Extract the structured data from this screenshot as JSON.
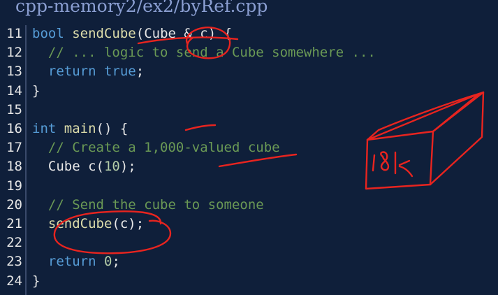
{
  "window": {
    "title": "cpp-memory2/ex2/byRef.cpp"
  },
  "editor": {
    "lines": [
      {
        "number": "11",
        "tokens": [
          {
            "t": "bool",
            "c": "kw"
          },
          {
            "t": " ",
            "c": "pl"
          },
          {
            "t": "sendCube",
            "c": "fn"
          },
          {
            "t": "(",
            "c": "pl"
          },
          {
            "t": "Cube",
            "c": "ty"
          },
          {
            "t": " & c) {",
            "c": "pl"
          }
        ]
      },
      {
        "number": "12",
        "tokens": [
          {
            "t": "  // ... logic to send a Cube somewhere ...",
            "c": "cm"
          }
        ]
      },
      {
        "number": "13",
        "tokens": [
          {
            "t": "  ",
            "c": "pl"
          },
          {
            "t": "return",
            "c": "kw"
          },
          {
            "t": " ",
            "c": "pl"
          },
          {
            "t": "true",
            "c": "kw"
          },
          {
            "t": ";",
            "c": "pl"
          }
        ]
      },
      {
        "number": "14",
        "tokens": [
          {
            "t": "}",
            "c": "pl"
          }
        ]
      },
      {
        "number": "15",
        "tokens": []
      },
      {
        "number": "16",
        "tokens": [
          {
            "t": "int",
            "c": "kw"
          },
          {
            "t": " ",
            "c": "pl"
          },
          {
            "t": "main",
            "c": "fn"
          },
          {
            "t": "() {",
            "c": "pl"
          }
        ]
      },
      {
        "number": "17",
        "tokens": [
          {
            "t": "  // Create a 1,000-valued cube",
            "c": "cm"
          }
        ]
      },
      {
        "number": "18",
        "tokens": [
          {
            "t": "  Cube c(",
            "c": "pl"
          },
          {
            "t": "10",
            "c": "num"
          },
          {
            "t": ");",
            "c": "pl"
          }
        ]
      },
      {
        "number": "19",
        "tokens": []
      },
      {
        "number": "20",
        "tokens": [
          {
            "t": "  // Send the cube to someone",
            "c": "cm"
          }
        ]
      },
      {
        "number": "21",
        "tokens": [
          {
            "t": "  ",
            "c": "pl"
          },
          {
            "t": "sendCube",
            "c": "fn"
          },
          {
            "t": "(c);",
            "c": "pl"
          }
        ]
      },
      {
        "number": "22",
        "tokens": []
      },
      {
        "number": "23",
        "tokens": [
          {
            "t": "  ",
            "c": "pl"
          },
          {
            "t": "return",
            "c": "kw"
          },
          {
            "t": " ",
            "c": "pl"
          },
          {
            "t": "0",
            "c": "num"
          },
          {
            "t": ";",
            "c": "pl"
          }
        ]
      },
      {
        "number": "24",
        "tokens": [
          {
            "t": "}",
            "c": "pl"
          }
        ]
      }
    ]
  },
  "annotation": {
    "handwritten_label": "8k"
  },
  "colors": {
    "background": "#0f1f3a",
    "keyword": "#569cd6",
    "function": "#dcdcaa",
    "comment": "#6a9955",
    "number": "#b5cea8",
    "title": "#8a9ed1",
    "annotation": "#e8241f"
  }
}
